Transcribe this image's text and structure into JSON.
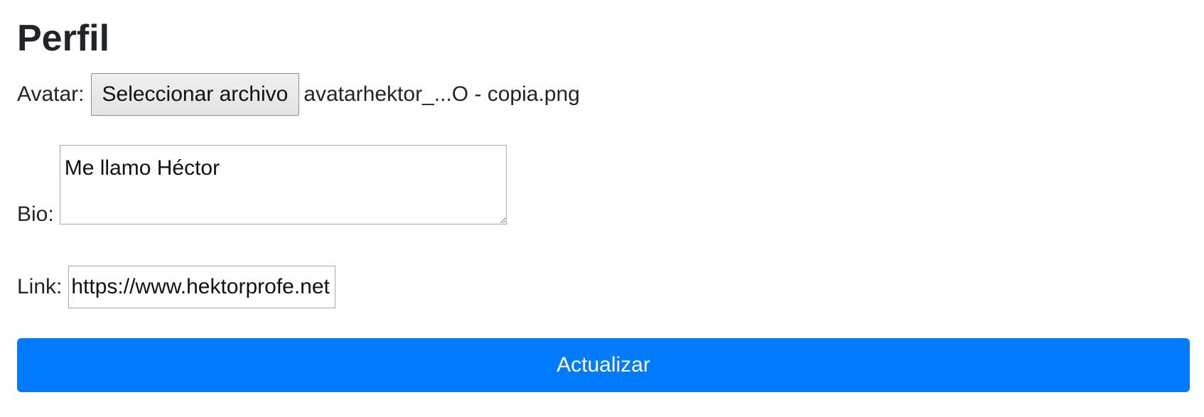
{
  "page": {
    "title": "Perfil"
  },
  "form": {
    "avatar": {
      "label": "Avatar:",
      "button_label": "Seleccionar archivo",
      "file_name": "avatarhektor_...O - copia.png"
    },
    "bio": {
      "label": "Bio:",
      "value": "Me llamo Héctor"
    },
    "link": {
      "label": "Link:",
      "value": "https://www.hektorprofe.net"
    },
    "submit_label": "Actualizar"
  },
  "colors": {
    "primary": "#007bff",
    "text": "#212529"
  }
}
